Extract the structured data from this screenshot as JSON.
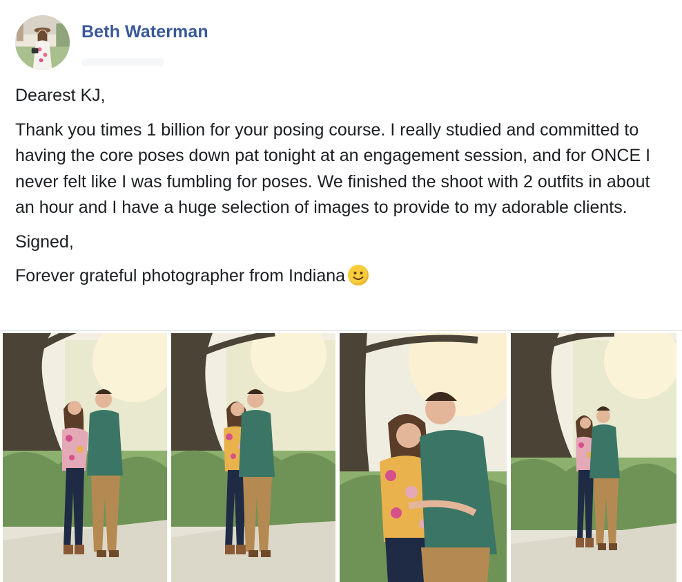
{
  "post": {
    "author": "Beth Waterman",
    "paragraphs": [
      "Dearest KJ,",
      "Thank you times 1 billion for your posing course. I really studied and committed to having the core poses down pat tonight at an engagement session, and for ONCE I never felt like I was fumbling for poses. We finished the shoot with 2 outfits in about an hour and I have a huge selection of images to provide to my adorable clients.",
      "Signed,",
      "Forever grateful photographer from Indiana"
    ],
    "emoji": "slightly-smiling-face-icon",
    "photos": [
      {
        "name": "engagement-photo-1",
        "pose": "couple standing, woman looking up at man"
      },
      {
        "name": "engagement-photo-2",
        "pose": "couple standing, smiling at camera"
      },
      {
        "name": "engagement-photo-3",
        "pose": "close-up, man kissing woman's forehead"
      },
      {
        "name": "engagement-photo-4",
        "pose": "couple standing, wide shot under tree"
      }
    ]
  },
  "colors": {
    "author": "#385898",
    "text": "#1c1e21",
    "shirt": "#3a7566",
    "pants": "#b58a52",
    "jeans": "#1f2b45",
    "blouse": "#e9b24d",
    "foliage": "#7fa064"
  }
}
